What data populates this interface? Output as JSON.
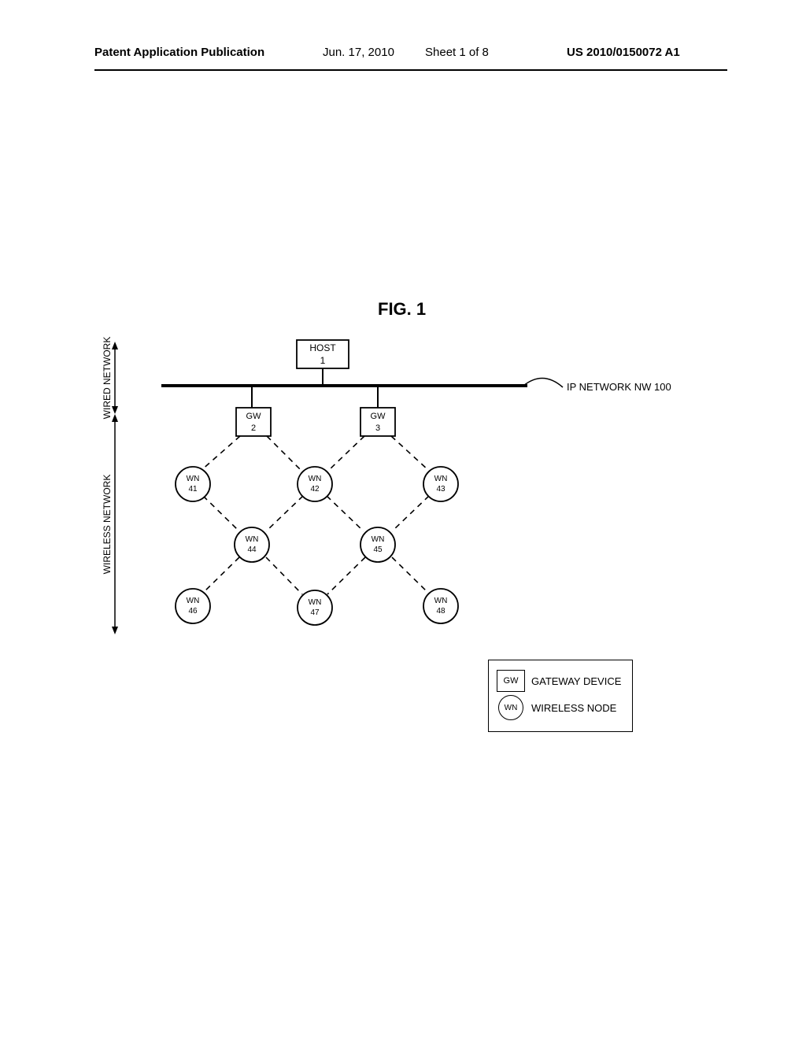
{
  "header": {
    "left": "Patent Application Publication",
    "date": "Jun. 17, 2010",
    "sheet": "Sheet 1 of 8",
    "pubno": "US 2010/0150072 A1"
  },
  "figure": {
    "title": "FIG. 1",
    "side_labels": {
      "wired": "WIRED NETWORK",
      "wireless": "WIRELESS NETWORK"
    },
    "ip_label": "IP NETWORK NW 100",
    "host": {
      "line1": "HOST",
      "line2": "1"
    },
    "gateways": [
      {
        "line1": "GW",
        "line2": "2"
      },
      {
        "line1": "GW",
        "line2": "3"
      }
    ],
    "nodes": [
      {
        "line1": "WN",
        "line2": "41"
      },
      {
        "line1": "WN",
        "line2": "42"
      },
      {
        "line1": "WN",
        "line2": "43"
      },
      {
        "line1": "WN",
        "line2": "44"
      },
      {
        "line1": "WN",
        "line2": "45"
      },
      {
        "line1": "WN",
        "line2": "46"
      },
      {
        "line1": "WN",
        "line2": "47"
      },
      {
        "line1": "WN",
        "line2": "48"
      }
    ]
  },
  "legend": {
    "gw_abbr": "GW",
    "gw_text": "GATEWAY DEVICE",
    "wn_abbr": "WN",
    "wn_text": "WIRELESS NODE"
  }
}
